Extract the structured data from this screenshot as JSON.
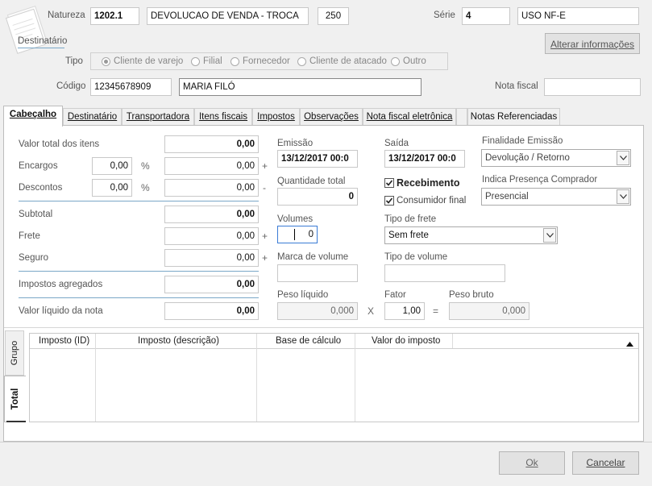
{
  "header": {
    "natureza_label": "Natureza",
    "natureza_code": "1202.1",
    "natureza_desc": "DEVOLUCAO DE VENDA - TROCA",
    "natureza_num": "250",
    "serie_label": "Série",
    "serie_value": "4",
    "serie_desc": "USO NF-E",
    "destinatario_label": "Destinatário",
    "alterar_button": "Alterar informações",
    "tipo_label": "Tipo",
    "tipo_options": [
      "Cliente de varejo",
      "Filial",
      "Fornecedor",
      "Cliente de atacado",
      "Outro"
    ],
    "tipo_selected": "Cliente de varejo",
    "codigo_label": "Código",
    "codigo_value": "12345678909",
    "nome_value": "MARIA FILÓ",
    "nota_fiscal_label": "Nota fiscal",
    "nota_fiscal_value": ""
  },
  "tabs": [
    {
      "label": "Cabeçalho",
      "active": true
    },
    {
      "label": "Destinatário",
      "active": false
    },
    {
      "label": "Transportadora",
      "active": false
    },
    {
      "label": "Itens fiscais",
      "active": false
    },
    {
      "label": "Impostos",
      "active": false
    },
    {
      "label": "Observações",
      "active": false
    },
    {
      "label": "Nota fiscal eletrônica",
      "active": false
    },
    {
      "label": "Notas Referenciadas",
      "active": false
    }
  ],
  "totals": {
    "valor_total_label": "Valor total dos itens",
    "valor_total": "0,00",
    "encargos_label": "Encargos",
    "encargos_pct": "0,00",
    "encargos_val": "0,00",
    "descontos_label": "Descontos",
    "descontos_pct": "0,00",
    "descontos_val": "0,00",
    "pct_symbol": "%",
    "plus": "+",
    "minus": "-",
    "subtotal_label": "Subtotal",
    "subtotal": "0,00",
    "frete_label": "Frete",
    "frete": "0,00",
    "seguro_label": "Seguro",
    "seguro": "0,00",
    "impostos_label": "Impostos agregados",
    "impostos": "0,00",
    "valor_liquido_label": "Valor líquido da nota",
    "valor_liquido": "0,00"
  },
  "middle": {
    "emissao_label": "Emissão",
    "emissao": "13/12/2017 00:0",
    "saida_label": "Saída",
    "saida": "13/12/2017 00:0",
    "quantidade_label": "Quantidade total",
    "quantidade": "0",
    "recebimento_label": "Recebimento",
    "consumidor_label": "Consumidor final",
    "volumes_label": "Volumes",
    "volumes": "0",
    "tipo_frete_label": "Tipo de frete",
    "tipo_frete": "Sem frete",
    "marca_label": "Marca de volume",
    "tipo_volume_label": "Tipo de volume",
    "peso_liquido_label": "Peso líquido",
    "peso_liquido": "0,000",
    "times": "X",
    "fator_label": "Fator",
    "fator": "1,00",
    "equals": "=",
    "peso_bruto_label": "Peso bruto",
    "peso_bruto": "0,000"
  },
  "right": {
    "finalidade_label": "Finalidade Emissão",
    "finalidade": "Devolução / Retorno",
    "presenca_label": "Indica Presença Comprador",
    "presenca": "Presencial"
  },
  "grid": {
    "side_tabs": [
      "Grupo",
      "Total"
    ],
    "columns": [
      "Imposto (ID)",
      "Imposto (descrição)",
      "Base de cálculo",
      "Valor do imposto"
    ]
  },
  "footer": {
    "ok": "Ok",
    "cancel": "Cancelar"
  },
  "colors": {
    "accent_line": "#7aa7c7"
  },
  "icons": [
    "note-icon",
    "chevron-down-icon",
    "sort-up-icon",
    "checkbox-checked-icon"
  ]
}
